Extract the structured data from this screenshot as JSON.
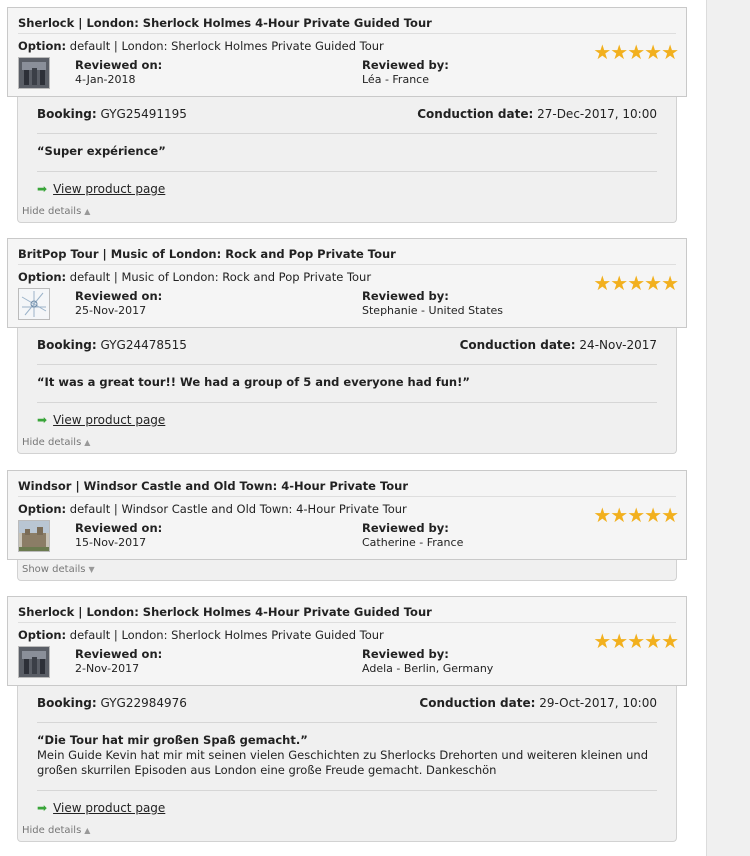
{
  "labels": {
    "option": "Option:",
    "reviewed_on": "Reviewed on:",
    "reviewed_by": "Reviewed by:",
    "booking": "Booking:",
    "conduction_date": "Conduction date:",
    "view_product": "View product page",
    "hide_details": "Hide details",
    "show_details": "Show details"
  },
  "colors": {
    "stars": "#f2b01e",
    "arrow": "#3aa53a"
  },
  "reviews": [
    {
      "title": "Sherlock | London: Sherlock Holmes 4-Hour Private Guided Tour",
      "option_text": "default | London: Sherlock Holmes Private Guided Tour",
      "reviewed_on": "4-Jan-2018",
      "reviewed_by": "Léa - France",
      "rating": 5,
      "stars": "★★★★★",
      "thumbnail_icon": "sherlock-photo-thumbnail",
      "expanded": true,
      "booking": "GYG25491195",
      "conduction_date": "27-Dec-2017, 10:00",
      "quote": "“Super expérience”",
      "body": ""
    },
    {
      "title": "BritPop Tour | Music of London: Rock and Pop Private Tour",
      "option_text": "default | Music of London: Rock and Pop Private Tour",
      "reviewed_on": "25-Nov-2017",
      "reviewed_by": "Stephanie - United States",
      "rating": 5,
      "stars": "★★★★★",
      "thumbnail_icon": "map-thumbnail",
      "expanded": true,
      "booking": "GYG24478515",
      "conduction_date": "24-Nov-2017",
      "quote": "“It was a great tour!! We had a group of 5 and everyone had fun!”",
      "body": ""
    },
    {
      "title": "Windsor | Windsor Castle and Old Town: 4-Hour Private Tour",
      "option_text": "default | Windsor Castle and Old Town: 4-Hour Private Tour",
      "reviewed_on": "15-Nov-2017",
      "reviewed_by": "Catherine - France",
      "rating": 5,
      "stars": "★★★★★",
      "thumbnail_icon": "castle-photo-thumbnail",
      "expanded": false
    },
    {
      "title": "Sherlock | London: Sherlock Holmes 4-Hour Private Guided Tour",
      "option_text": "default | London: Sherlock Holmes Private Guided Tour",
      "reviewed_on": "2-Nov-2017",
      "reviewed_by": "Adela - Berlin, Germany",
      "rating": 5,
      "stars": "★★★★★",
      "thumbnail_icon": "sherlock-photo-thumbnail",
      "expanded": true,
      "booking": "GYG22984976",
      "conduction_date": "29-Oct-2017, 10:00",
      "quote": "“Die Tour hat mir großen Spaß gemacht.”",
      "body": "Mein Guide Kevin hat mir mit seinen vielen Geschichten zu Sherlocks Drehorten und weiteren kleinen und großen skurrilen Episoden aus London eine große Freude gemacht. Dankeschön"
    }
  ]
}
